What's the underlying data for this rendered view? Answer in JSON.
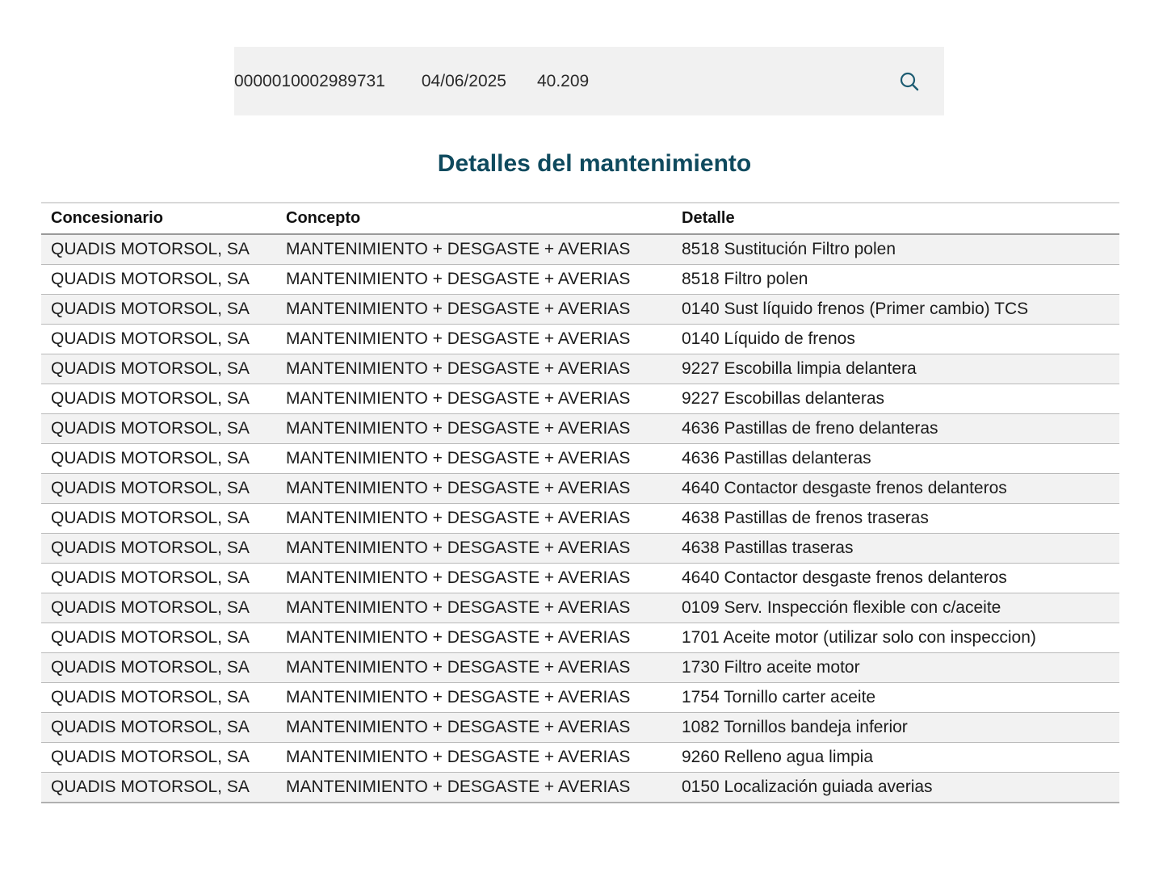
{
  "search": {
    "reference": "0000010002989731",
    "date": "04/06/2025",
    "mileage": "40.209",
    "button_icon": "search-icon"
  },
  "page_title": "Detalles del mantenimiento",
  "table": {
    "columns": [
      "Concesionario",
      "Concepto",
      "Detalle"
    ],
    "rows": [
      [
        "QUADIS MOTORSOL, SA",
        "MANTENIMIENTO + DESGASTE + AVERIAS",
        "8518 Sustitución Filtro polen"
      ],
      [
        "QUADIS MOTORSOL, SA",
        "MANTENIMIENTO + DESGASTE + AVERIAS",
        "8518 Filtro polen"
      ],
      [
        "QUADIS MOTORSOL, SA",
        "MANTENIMIENTO + DESGASTE + AVERIAS",
        "0140 Sust líquido frenos (Primer cambio) TCS"
      ],
      [
        "QUADIS MOTORSOL, SA",
        "MANTENIMIENTO + DESGASTE + AVERIAS",
        "0140 Líquido de frenos"
      ],
      [
        "QUADIS MOTORSOL, SA",
        "MANTENIMIENTO + DESGASTE + AVERIAS",
        "9227 Escobilla limpia delantera"
      ],
      [
        "QUADIS MOTORSOL, SA",
        "MANTENIMIENTO + DESGASTE + AVERIAS",
        "9227 Escobillas delanteras"
      ],
      [
        "QUADIS MOTORSOL, SA",
        "MANTENIMIENTO + DESGASTE + AVERIAS",
        "4636 Pastillas de freno delanteras"
      ],
      [
        "QUADIS MOTORSOL, SA",
        "MANTENIMIENTO + DESGASTE + AVERIAS",
        "4636 Pastillas delanteras"
      ],
      [
        "QUADIS MOTORSOL, SA",
        "MANTENIMIENTO + DESGASTE + AVERIAS",
        "4640 Contactor desgaste frenos delanteros"
      ],
      [
        "QUADIS MOTORSOL, SA",
        "MANTENIMIENTO + DESGASTE + AVERIAS",
        "4638 Pastillas de frenos traseras"
      ],
      [
        "QUADIS MOTORSOL, SA",
        "MANTENIMIENTO + DESGASTE + AVERIAS",
        "4638 Pastillas traseras"
      ],
      [
        "QUADIS MOTORSOL, SA",
        "MANTENIMIENTO + DESGASTE + AVERIAS",
        "4640 Contactor desgaste frenos delanteros"
      ],
      [
        "QUADIS MOTORSOL, SA",
        "MANTENIMIENTO + DESGASTE + AVERIAS",
        "0109 Serv. Inspección flexible con c/aceite"
      ],
      [
        "QUADIS MOTORSOL, SA",
        "MANTENIMIENTO + DESGASTE + AVERIAS",
        "1701 Aceite motor (utilizar solo con inspeccion)"
      ],
      [
        "QUADIS MOTORSOL, SA",
        "MANTENIMIENTO + DESGASTE + AVERIAS",
        "1730 Filtro aceite motor"
      ],
      [
        "QUADIS MOTORSOL, SA",
        "MANTENIMIENTO + DESGASTE + AVERIAS",
        "1754 Tornillo carter aceite"
      ],
      [
        "QUADIS MOTORSOL, SA",
        "MANTENIMIENTO + DESGASTE + AVERIAS",
        "1082 Tornillos bandeja inferior"
      ],
      [
        "QUADIS MOTORSOL, SA",
        "MANTENIMIENTO + DESGASTE + AVERIAS",
        "9260 Relleno agua limpia"
      ],
      [
        "QUADIS MOTORSOL, SA",
        "MANTENIMIENTO + DESGASTE + AVERIAS",
        "0150 Localización guiada averias"
      ]
    ]
  },
  "colors": {
    "accent": "#0f4a5e",
    "search_background": "#f1f1f1",
    "row_alt": "#f2f2f2"
  }
}
